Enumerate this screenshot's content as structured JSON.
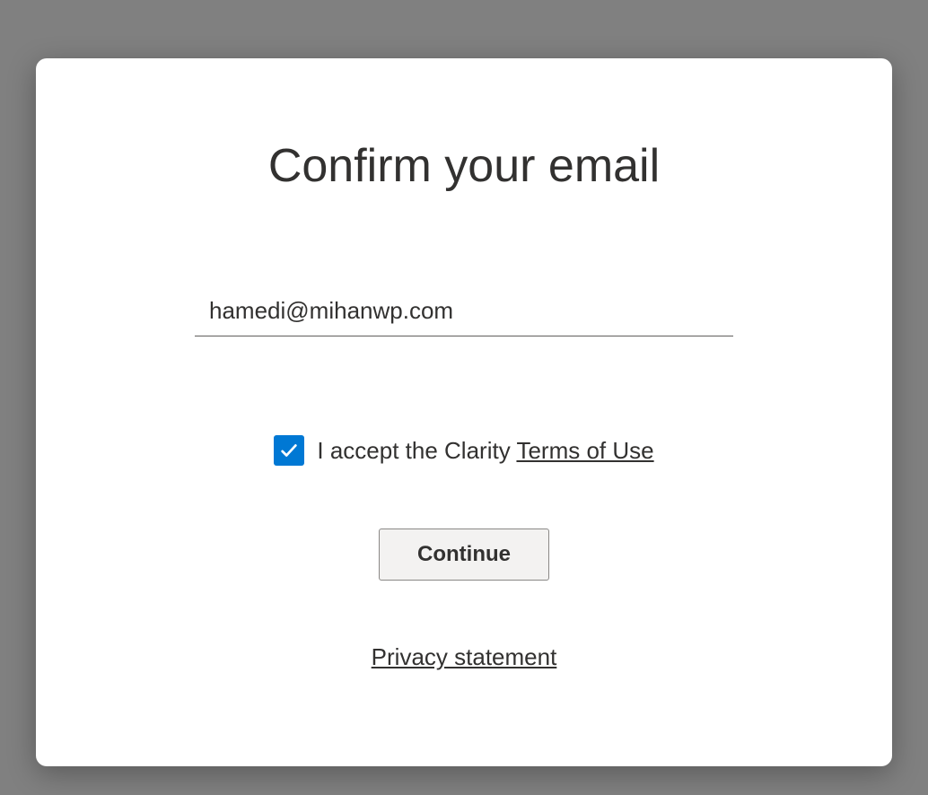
{
  "dialog": {
    "title": "Confirm your email",
    "email": "hamedi@mihanwp.com",
    "checkbox": {
      "checked": true,
      "label_prefix": "I accept the Clarity ",
      "terms_link": "Terms of Use"
    },
    "continue_button": "Continue",
    "privacy_link": "Privacy statement"
  }
}
